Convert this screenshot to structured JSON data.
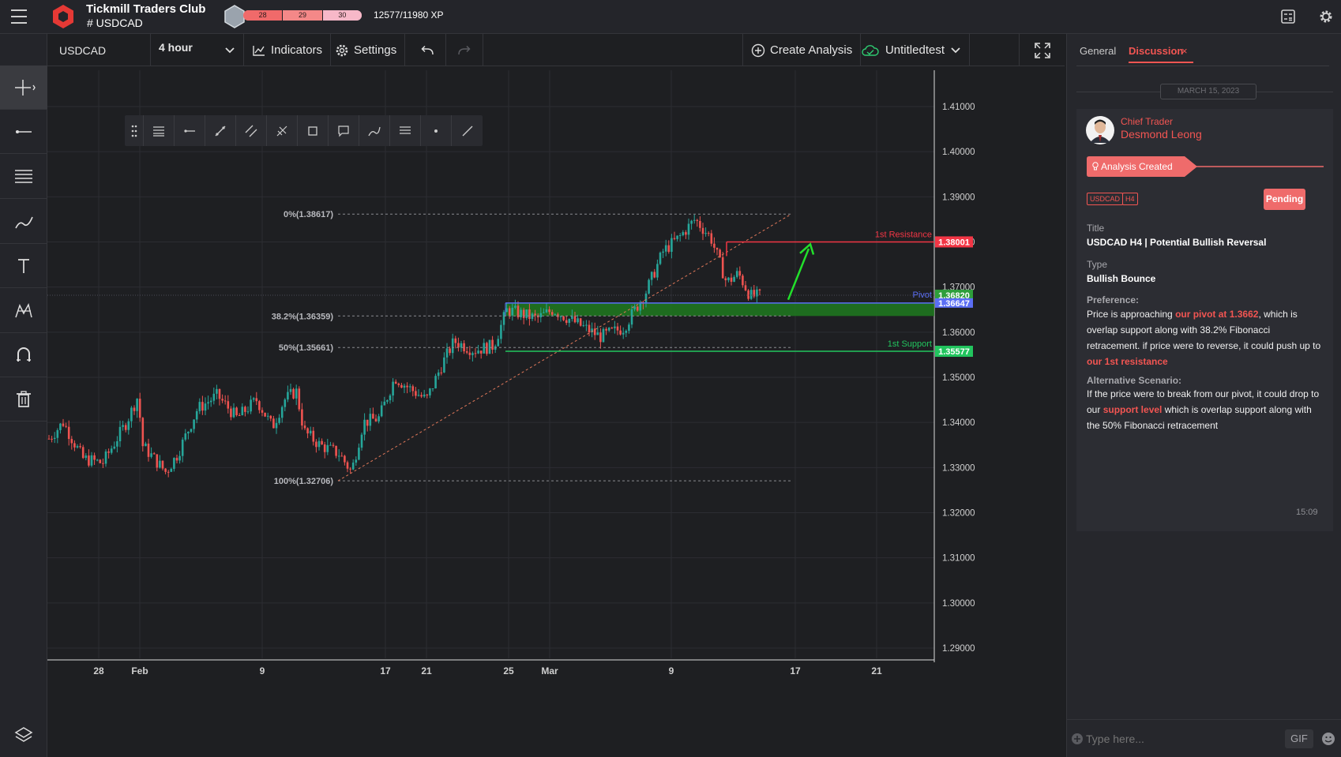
{
  "header": {
    "club_name": "Tickmill Traders Club",
    "channel": "# USDCAD",
    "xp_levels": [
      "28",
      "29",
      "30"
    ],
    "xp_text": "12577/11980 XP"
  },
  "toolbar": {
    "symbol": "USDCAD",
    "timeframe": "4 hour",
    "indicators": "Indicators",
    "settings": "Settings",
    "create_analysis": "Create Analysis",
    "template_name": "Untitledtest"
  },
  "chart": {
    "price_axis": [
      "1.41000",
      "1.40000",
      "1.39000",
      "1.38000",
      "1.37000",
      "1.36000",
      "1.35000",
      "1.34000",
      "1.33000",
      "1.32000",
      "1.31000",
      "1.30000",
      "1.29000"
    ],
    "time_axis": [
      "28",
      "Feb",
      "9",
      "17",
      "21",
      "25",
      "Mar",
      "9",
      "17",
      "21"
    ],
    "fib_labels": [
      "0%(1.38617)",
      "38.2%(1.36359)",
      "50%(1.35661)",
      "100%(1.32706)"
    ],
    "resistance_label": "1st Resistance",
    "resistance_price": "1.38001",
    "pivot_label": "Pivot",
    "pivot_price_1": "1.36820",
    "pivot_price_2": "1.36647",
    "support_label": "1st Support",
    "support_price": "1.35577",
    "colors": {
      "up": "#26a69a",
      "down": "#ef5350",
      "resistance": "#f23645",
      "support": "#22c55e",
      "pivot": "#5b6ef5",
      "arrow": "#22e02b"
    }
  },
  "panel": {
    "tab_general": "General",
    "tab_discussion": "Discussion",
    "tab_close": "×",
    "date": "MARCH 15, 2023",
    "author_role": "Chief Trader",
    "author_name": "Desmond Leong",
    "status_banner": "Analysis Created",
    "tags": [
      "USDCAD",
      "H4"
    ],
    "status": "Pending",
    "title_label": "Title",
    "title_value": "USDCAD H4 | Potential Bullish Reversal",
    "type_label": "Type",
    "type_value": "Bullish Bounce",
    "preference_label": "Preference:",
    "pref_1": "Price is approaching ",
    "pref_hl1": "our pivot at 1.3662",
    "pref_2": ", which is overlap support along with 38.2% Fibonacci retracement. if price were to reverse, it could push up to ",
    "pref_hl2": "our 1st resistance",
    "alt_label": "Alternative Scenario:",
    "alt_1": "If the price were to break from our pivot, it could drop to our ",
    "alt_hl": "support level",
    "alt_2": " which is overlap support along with the 50% Fibonacci retracement",
    "time": "15:09",
    "composer_placeholder": "Type here...",
    "gif_label": "GIF"
  }
}
